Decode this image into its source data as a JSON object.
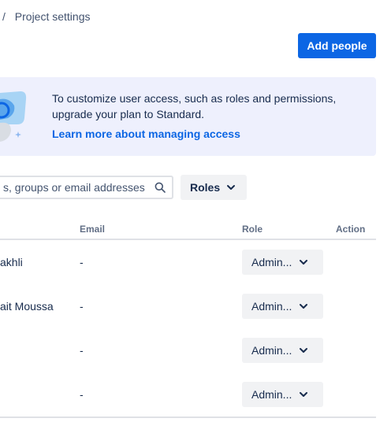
{
  "breadcrumb": {
    "separator": "/",
    "current": "Project settings"
  },
  "header": {
    "add_people_label": "Add people"
  },
  "banner": {
    "text": "To customize user access, such as roles and permissions, upgrade your plan to Standard.",
    "link": "Learn more about managing access"
  },
  "filters": {
    "search_placeholder": "s, groups or email addresses",
    "roles_label": "Roles"
  },
  "table": {
    "columns": {
      "email": "Email",
      "role": "Role",
      "action": "Action"
    },
    "rows": [
      {
        "name": "akhli",
        "email": "-",
        "role": "Admin..."
      },
      {
        "name": "ait Moussa",
        "email": "-",
        "role": "Admin..."
      },
      {
        "name": "",
        "email": "-",
        "role": "Admin..."
      },
      {
        "name": "",
        "email": "-",
        "role": "Admin..."
      }
    ]
  },
  "colors": {
    "primary": "#0c66e4",
    "banner_bg": "#eef0fd",
    "button_neutral": "#f1f2f4"
  }
}
